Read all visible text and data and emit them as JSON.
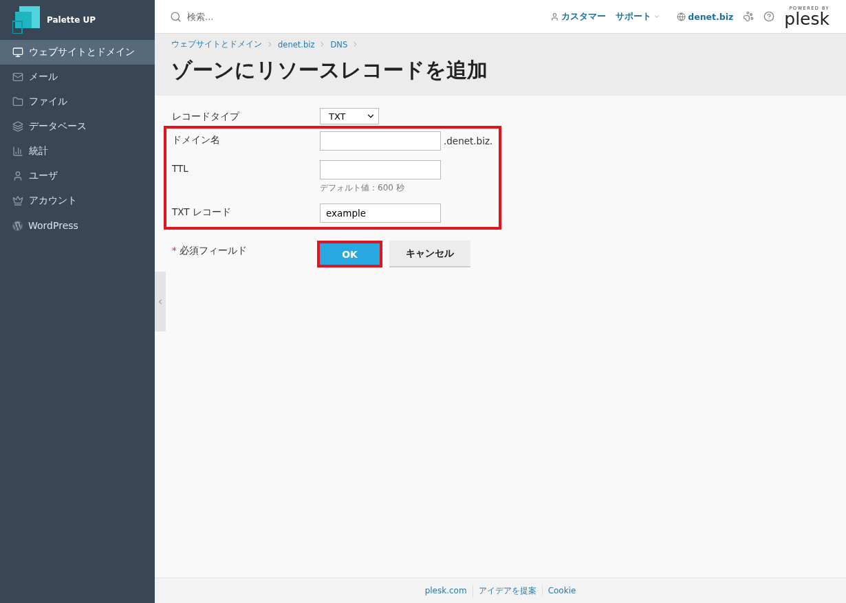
{
  "brand": {
    "name": "Palette UP"
  },
  "sidebar": {
    "items": [
      {
        "label": "ウェブサイトとドメイン",
        "selected": true
      },
      {
        "label": "メール",
        "selected": false
      },
      {
        "label": "ファイル",
        "selected": false
      },
      {
        "label": "データベース",
        "selected": false
      },
      {
        "label": "統計",
        "selected": false
      },
      {
        "label": "ユーザ",
        "selected": false
      },
      {
        "label": "アカウント",
        "selected": false
      },
      {
        "label": "WordPress",
        "selected": false
      }
    ]
  },
  "header": {
    "search": {
      "placeholder": "検索..."
    },
    "customer": "カスタマー",
    "support": "サポート",
    "domain": "denet.biz",
    "powered_by": "POWERED BY",
    "logo": "plesk"
  },
  "breadcrumbs": [
    "ウェブサイトとドメイン",
    "denet.biz",
    "DNS"
  ],
  "title": "ゾーンにリソースレコードを追加",
  "form": {
    "record_type": {
      "label": "レコードタイプ",
      "value": "TXT"
    },
    "highlighted": true,
    "fields": [
      {
        "label": "ドメイン名",
        "suffix": ".denet.biz."
      },
      {
        "label": "TTL",
        "hint": "デフォルト値：600 秒"
      },
      {
        "label": "TXT レコード",
        "value": "example"
      }
    ],
    "required_note": {
      "mark": "*",
      "text": "必須フィールド"
    },
    "buttons": [
      {
        "label": "OK",
        "kind": "primary",
        "highlighted": true
      },
      {
        "label": "キャンセル",
        "kind": "secondary",
        "highlighted": false
      }
    ]
  },
  "footer": {
    "links": [
      "plesk.com",
      "アイデアを提案",
      "Cookie"
    ]
  }
}
